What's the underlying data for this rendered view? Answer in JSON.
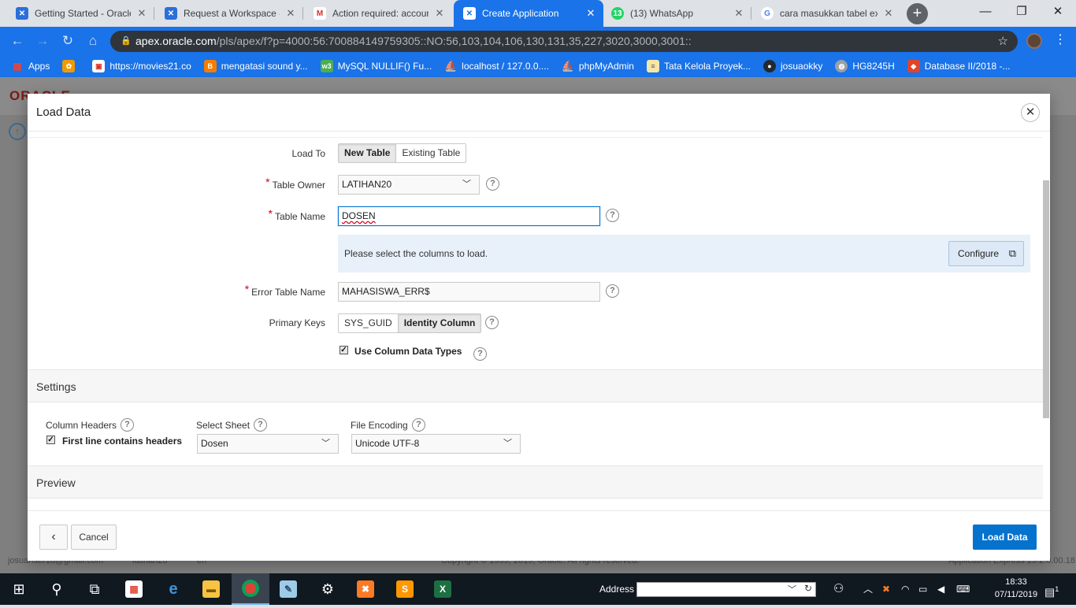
{
  "browser": {
    "tabs": [
      {
        "title": "Getting Started - Oracle",
        "icon": "oracle-x-icon",
        "color": "#2a6fdb"
      },
      {
        "title": "Request a Workspace -",
        "icon": "apex-icon",
        "color": "#2a6fdb"
      },
      {
        "title": "Action required: accoun",
        "icon": "gmail-icon",
        "color": "#d93025"
      },
      {
        "title": "Create Application",
        "icon": "apex-icon",
        "color": "#ffffff",
        "active": true
      },
      {
        "title": "(13) WhatsApp",
        "icon": "whatsapp-icon",
        "color": "#25d366",
        "badge": "13"
      },
      {
        "title": "cara masukkan tabel ex",
        "icon": "google-icon",
        "color": "#4285f4"
      }
    ],
    "url_host": "apex.oracle.com",
    "url_path": "/pls/apex/f?p=4000:56:700884149759305::NO:56,103,104,106,130,131,35,227,3020,3000,3001::",
    "bookmarks": [
      {
        "label": "Apps",
        "icon": "apps-grid-icon",
        "color": "#ea4335"
      },
      {
        "label": "",
        "icon": "puzzle-icon",
        "color": "#f29900"
      },
      {
        "label": "https://movies21.co",
        "icon": "movies-icon",
        "color": "#d93025"
      },
      {
        "label": "mengatasi sound y...",
        "icon": "blogger-icon",
        "color": "#f57d00"
      },
      {
        "label": "MySQL NULLIF() Fu...",
        "icon": "w3-icon",
        "color": "#4caf50"
      },
      {
        "label": "localhost / 127.0.0....",
        "icon": "phpmyadmin-icon",
        "color": "#f0a30a"
      },
      {
        "label": "phpMyAdmin",
        "icon": "phpmyadmin-icon",
        "color": "#f0a30a"
      },
      {
        "label": "Tata Kelola Proyek...",
        "icon": "doc-icon",
        "color": "#f5e6a8"
      },
      {
        "label": "josuaokky",
        "icon": "github-icon",
        "color": "#24292e"
      },
      {
        "label": "HG8245H",
        "icon": "globe-icon",
        "color": "#9aa0a6"
      },
      {
        "label": "Database II/2018 -...",
        "icon": "gitlab-icon",
        "color": "#e24329"
      }
    ]
  },
  "page_bg": {
    "logo": "ORACLE",
    "footer_user": "josuanser18@gmail.com",
    "footer_schema": "latihan20",
    "footer_lang": "en",
    "footer_copyright": "Copyright © 1999, 2019, Oracle. All rights reserved.",
    "footer_version": "Application Express 19.2.0.00.18"
  },
  "modal": {
    "title": "Load Data",
    "close_symbol": "✕",
    "load_to": {
      "label": "Load To",
      "options": [
        "New Table",
        "Existing Table"
      ],
      "selected": "New Table"
    },
    "table_owner": {
      "label": "Table Owner",
      "value": "LATIHAN20",
      "required": true
    },
    "table_name": {
      "label": "Table Name",
      "value": "DOSEN",
      "required": true
    },
    "columns_message": "Please select the columns to load.",
    "configure_label": "Configure",
    "error_table": {
      "label": "Error Table Name",
      "value": "MAHASISWA_ERR$",
      "required": true
    },
    "primary_keys": {
      "label": "Primary Keys",
      "options": [
        "SYS_GUID",
        "Identity Column"
      ],
      "selected": "Identity Column"
    },
    "use_column_types": {
      "label": "Use Column Data Types",
      "checked": true
    },
    "settings": {
      "title": "Settings",
      "column_headers_label": "Column Headers",
      "first_line_label": "First line contains headers",
      "first_line_checked": true,
      "select_sheet_label": "Select Sheet",
      "select_sheet_value": "Dosen",
      "file_encoding_label": "File Encoding",
      "file_encoding_value": "Unicode UTF-8"
    },
    "preview_title": "Preview",
    "buttons": {
      "back": "‹",
      "cancel": "Cancel",
      "load": "Load Data"
    }
  },
  "taskbar": {
    "address_label": "Address",
    "time": "18:33",
    "date": "07/11/2019",
    "notification_count": "1"
  },
  "colors": {
    "accent": "#1a73e8",
    "apex_blue": "#0572ce",
    "required": "#d0021b"
  }
}
